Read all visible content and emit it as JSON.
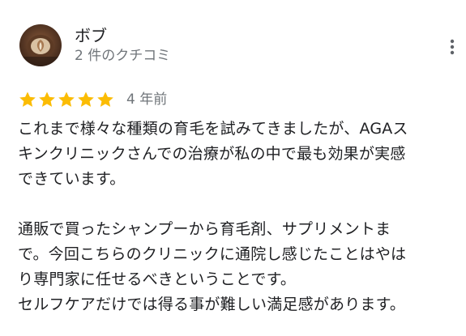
{
  "review": {
    "author_name": "ボブ",
    "author_meta": "2 件のクチコミ",
    "rating": 5,
    "rating_max": 5,
    "date": "4 年前",
    "paragraphs": [
      [
        "これまで様々な種類の育毛を試みてきましたが、AGAス",
        "キンクリニックさんでの治療が私の中で最も効果が実感",
        "できています。"
      ],
      [
        "通販で買ったシャンプーから育毛剤、サプリメントま",
        "で。今回こちらのクリニックに通院し感じたことはやは",
        "り専門家に任せるべきということです。",
        "セルフケアだけでは得る事が難しい満足感があります。"
      ]
    ]
  },
  "icons": {
    "avatar": "avatar-photo",
    "more": "more-vert-icon",
    "star": "star-icon"
  },
  "colors": {
    "star": "#fbbc04",
    "text": "#202124",
    "secondary_text": "#70757a"
  }
}
